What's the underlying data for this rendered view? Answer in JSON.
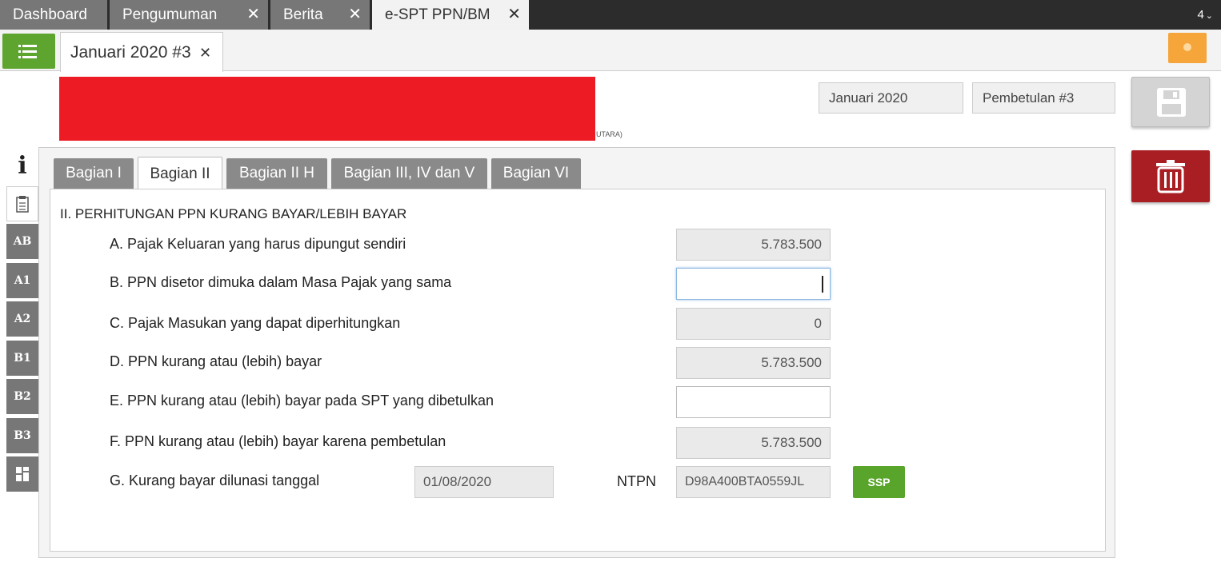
{
  "app_tabs": [
    {
      "label": "Dashboard",
      "closable": false
    },
    {
      "label": "Pengumuman",
      "closable": true
    },
    {
      "label": "Berita",
      "closable": true
    },
    {
      "label": "e-SPT PPN/BM",
      "closable": true,
      "active": true
    }
  ],
  "tab_count": "4",
  "document_tab": {
    "label": "Januari 2020 #3"
  },
  "header": {
    "redacted_suffix": "UTARA)",
    "period": "Januari 2020",
    "revision": "Pembetulan #3"
  },
  "side_nav": [
    {
      "label": "i",
      "icon": "info-icon"
    },
    {
      "label": "",
      "icon": "clipboard-icon",
      "active": true
    },
    {
      "label": "AB"
    },
    {
      "label": "A1"
    },
    {
      "label": "A2"
    },
    {
      "label": "B1"
    },
    {
      "label": "B2"
    },
    {
      "label": "B3"
    },
    {
      "label": "",
      "icon": "grid-icon"
    }
  ],
  "section_tabs": [
    "Bagian I",
    "Bagian II",
    "Bagian II H",
    "Bagian III, IV dan V",
    "Bagian VI"
  ],
  "active_section_tab": "Bagian II",
  "section": {
    "title": "II. PERHITUNGAN PPN KURANG BAYAR/LEBIH BAYAR",
    "rows": [
      {
        "label": "A. Pajak Keluaran yang harus dipungut sendiri",
        "value": "5.783.500",
        "editable": false
      },
      {
        "label": "B. PPN disetor dimuka dalam Masa Pajak yang sama",
        "value": "",
        "editable": true
      },
      {
        "label": "C. Pajak Masukan yang dapat diperhitungkan",
        "value": "0",
        "editable": false
      },
      {
        "label": "D. PPN kurang atau (lebih) bayar",
        "value": "5.783.500",
        "editable": false
      },
      {
        "label": "E. PPN kurang atau (lebih) bayar pada SPT yang dibetulkan",
        "value": "",
        "editable": true
      },
      {
        "label": "F. PPN kurang atau (lebih) bayar karena pembetulan",
        "value": "5.783.500",
        "editable": false
      }
    ],
    "payment": {
      "label": "G. Kurang bayar dilunasi tanggal",
      "date": "01/08/2020",
      "ntpn_label": "NTPN",
      "ntpn": "D98A400BTA0559JL",
      "ssp_label": "SSP"
    }
  },
  "colors": {
    "topbar": "#2d2c2c",
    "tab_inactive": "#777777",
    "menu_green": "#5ea52f",
    "bulb_orange": "#f5a53a",
    "redacted_red": "#ed1c24",
    "delete_red": "#a81e23",
    "ssp_green": "#59a52c"
  }
}
